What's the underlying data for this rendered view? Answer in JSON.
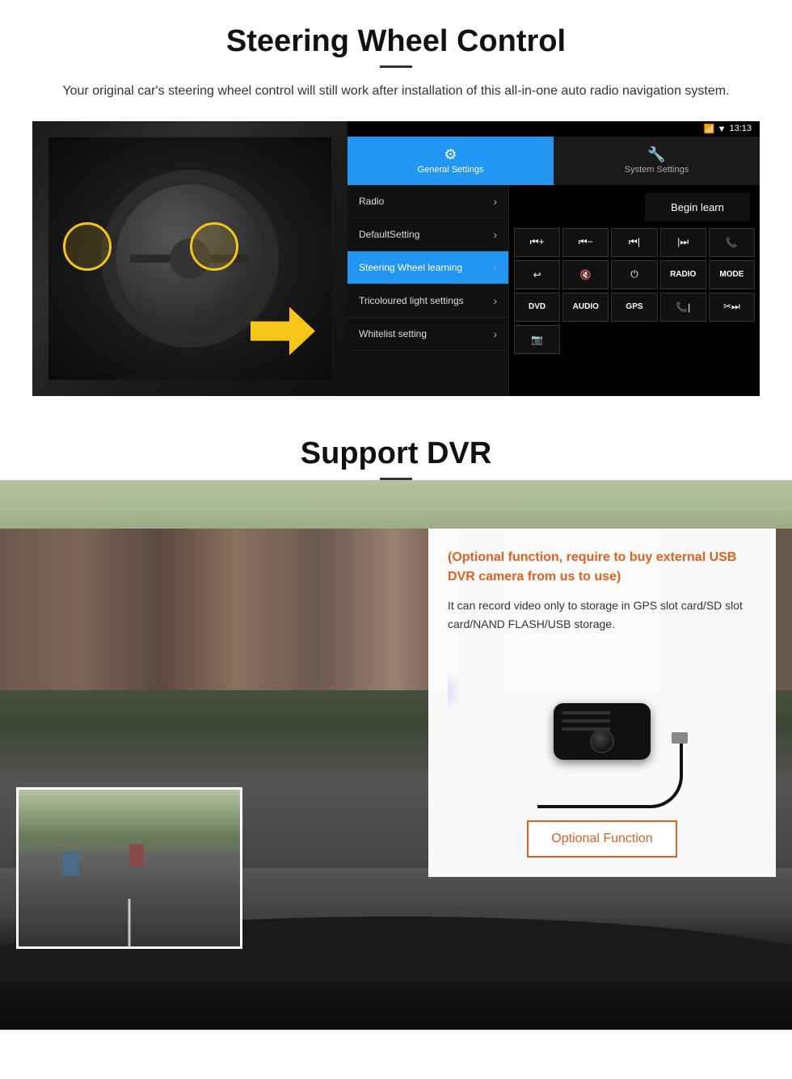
{
  "section1": {
    "title": "Steering Wheel Control",
    "description": "Your original car's steering wheel control will still work after installation of this all-in-one auto radio navigation system.",
    "statusbar": {
      "time": "13:13",
      "signal": "▼",
      "wifi": "▼"
    },
    "tabs": {
      "general": {
        "label": "General Settings",
        "icon": "⚙"
      },
      "system": {
        "label": "System Settings",
        "icon": "🔧"
      }
    },
    "menu": [
      {
        "label": "Radio",
        "active": false
      },
      {
        "label": "DefaultSetting",
        "active": false
      },
      {
        "label": "Steering Wheel learning",
        "active": true
      },
      {
        "label": "Tricoloured light settings",
        "active": false
      },
      {
        "label": "Whitelist setting",
        "active": false
      }
    ],
    "begin_learn": "Begin learn",
    "controls_row1": [
      "⏮+",
      "⏮−",
      "⏮|",
      "|⏭",
      "📞"
    ],
    "controls_row2": [
      "↩",
      "🔇",
      "⏻",
      "RADIO",
      "MODE"
    ],
    "controls_row3": [
      "DVD",
      "AUDIO",
      "GPS",
      "📞⏮|",
      "✂|⏭"
    ],
    "controls_row4_icon": "📷"
  },
  "section2": {
    "title": "Support DVR",
    "optional_note": "(Optional function, require to buy external USB DVR camera from us to use)",
    "description": "It can record video only to storage in GPS slot card/SD slot card/NAND FLASH/USB storage.",
    "optional_function_btn": "Optional Function"
  }
}
